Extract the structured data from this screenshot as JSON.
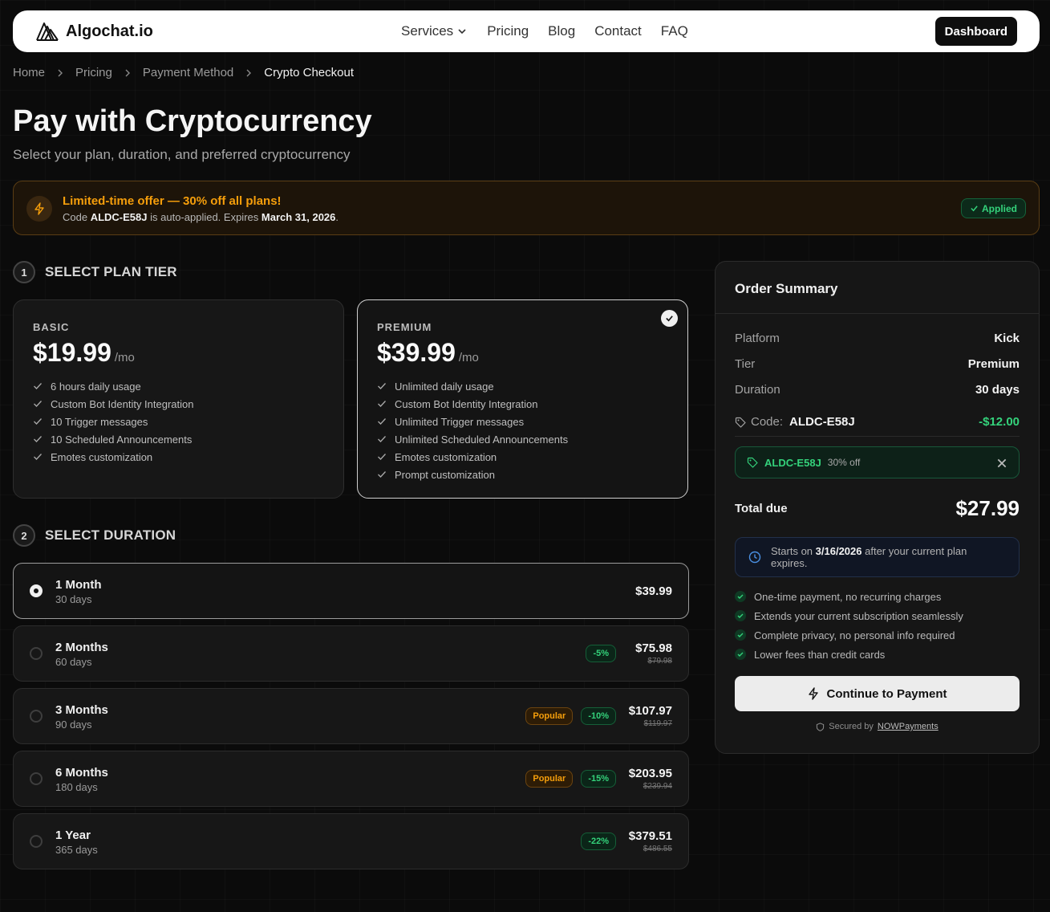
{
  "colors": {
    "background": "#0b0b0b",
    "accent_green": "#34d27b",
    "accent_orange": "#f59e0b",
    "card": "#171717"
  },
  "nav": {
    "brand": "Algochat.io",
    "links": [
      "Services",
      "Pricing",
      "Blog",
      "Contact",
      "FAQ"
    ],
    "dashboard_label": "Dashboard"
  },
  "breadcrumb": [
    "Home",
    "Pricing",
    "Payment Method",
    "Crypto Checkout"
  ],
  "header": {
    "title": "Pay with Cryptocurrency",
    "subtitle": "Select your plan, duration, and preferred cryptocurrency"
  },
  "offer": {
    "title": "Limited-time offer — 30% off all plans!",
    "text_prefix": "Code",
    "code": "ALDC-E58J",
    "text_mid": "is auto-applied. Expires",
    "expiry": "March 31, 2026",
    "text_end": ".",
    "badge": "Applied"
  },
  "steps": {
    "tier": {
      "num": "1",
      "label": "SELECT PLAN TIER"
    },
    "duration": {
      "num": "2",
      "label": "SELECT DURATION"
    }
  },
  "plans": [
    {
      "name": "BASIC",
      "price": "$19.99",
      "period": "/mo",
      "selected": false,
      "features": [
        "6 hours daily usage",
        "Custom Bot Identity Integration",
        "10 Trigger messages",
        "10 Scheduled Announcements",
        "Emotes customization"
      ]
    },
    {
      "name": "PREMIUM",
      "price": "$39.99",
      "period": "/mo",
      "selected": true,
      "features": [
        "Unlimited daily usage",
        "Custom Bot Identity Integration",
        "Unlimited Trigger messages",
        "Unlimited Scheduled Announcements",
        "Emotes customization",
        "Prompt customization"
      ]
    }
  ],
  "durations": [
    {
      "label": "1 Month",
      "days": "30 days",
      "price": "$39.99",
      "old_price": "",
      "discount": "",
      "popular": "",
      "selected": true
    },
    {
      "label": "2 Months",
      "days": "60 days",
      "price": "$75.98",
      "old_price": "$79.98",
      "discount": "-5%",
      "popular": "",
      "selected": false
    },
    {
      "label": "3 Months",
      "days": "90 days",
      "price": "$107.97",
      "old_price": "$119.97",
      "discount": "-10%",
      "popular": "Popular",
      "selected": false
    },
    {
      "label": "6 Months",
      "days": "180 days",
      "price": "$203.95",
      "old_price": "$239.94",
      "discount": "-15%",
      "popular": "Popular",
      "selected": false
    },
    {
      "label": "1 Year",
      "days": "365 days",
      "price": "$379.51",
      "old_price": "$486.55",
      "discount": "-22%",
      "popular": "",
      "selected": false
    }
  ],
  "summary": {
    "title": "Order Summary",
    "rows": [
      {
        "key": "Platform",
        "value": "Kick"
      },
      {
        "key": "Tier",
        "value": "Premium"
      },
      {
        "key": "Duration",
        "value": "30 days"
      }
    ],
    "code_label": "Code:",
    "code_value": "ALDC-E58J",
    "code_discount": "-$12.00",
    "coupon_code": "ALDC-E58J",
    "coupon_off": "30% off",
    "total_label": "Total due",
    "total_value": "$27.99",
    "info_prefix": "Starts on",
    "info_date": "3/16/2026",
    "info_suffix": "after your current plan expires.",
    "bullets": [
      "One-time payment, no recurring charges",
      "Extends your current subscription seamlessly",
      "Complete privacy, no personal info required",
      "Lower fees than credit cards"
    ],
    "pay_label": "Continue to Payment",
    "secured_prefix": "Secured by",
    "secured_link": "NOWPayments"
  }
}
